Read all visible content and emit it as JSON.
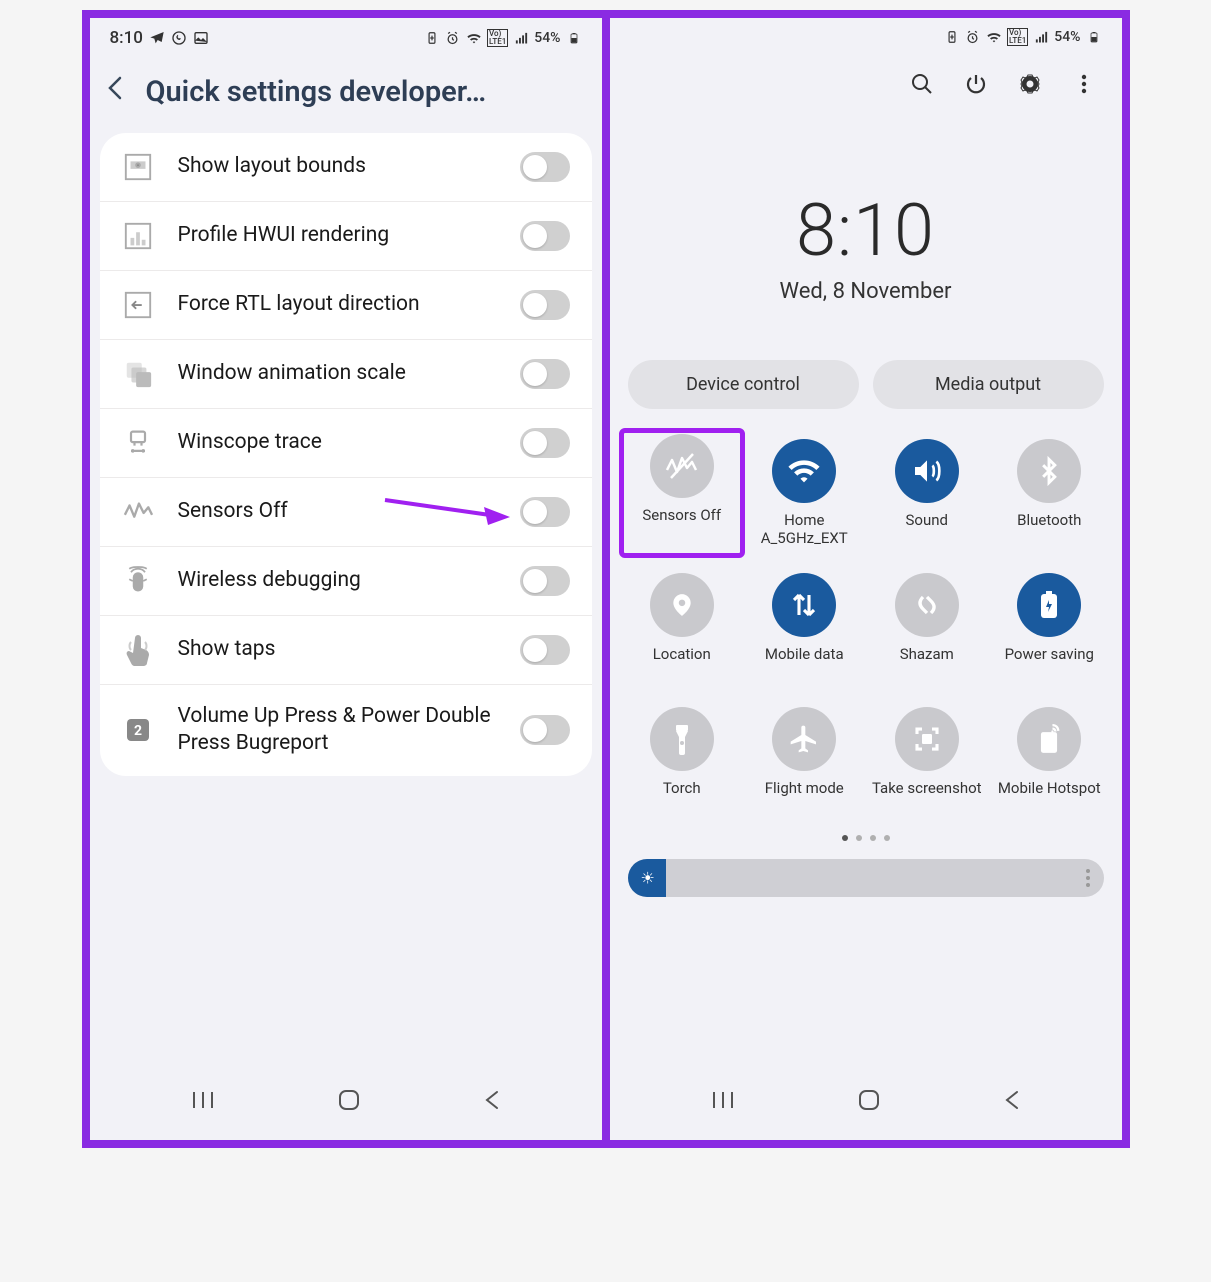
{
  "status": {
    "time": "8:10",
    "battery_pct": "54%"
  },
  "left": {
    "title": "Quick settings developer…",
    "items": [
      {
        "label": "Show layout bounds"
      },
      {
        "label": "Profile HWUI rendering"
      },
      {
        "label": "Force RTL layout direction"
      },
      {
        "label": "Window animation scale"
      },
      {
        "label": "Winscope trace"
      },
      {
        "label": "Sensors Off"
      },
      {
        "label": "Wireless debugging"
      },
      {
        "label": "Show taps"
      },
      {
        "label": "Volume Up Press & Power Double Press Bugreport"
      }
    ]
  },
  "right": {
    "time": "8:10",
    "date": "Wed, 8 November",
    "pills": {
      "device_control": "Device control",
      "media_output": "Media output"
    },
    "tiles": [
      {
        "label": "Sensors Off"
      },
      {
        "label": "Home A_5GHz_EXT"
      },
      {
        "label": "Sound"
      },
      {
        "label": "Bluetooth"
      },
      {
        "label": "Location"
      },
      {
        "label": "Mobile data"
      },
      {
        "label": "Shazam"
      },
      {
        "label": "Power saving"
      },
      {
        "label": "Torch"
      },
      {
        "label": "Flight mode"
      },
      {
        "label": "Take screenshot"
      },
      {
        "label": "Mobile Hotspot"
      }
    ]
  }
}
